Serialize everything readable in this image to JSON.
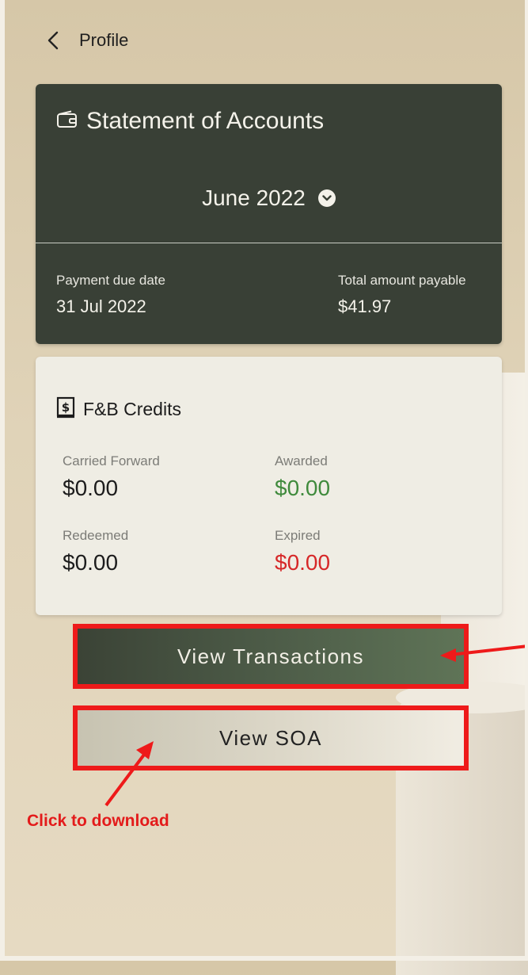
{
  "header": {
    "back_icon": "chevron-left-icon",
    "title": "Profile"
  },
  "statement": {
    "title": "Statement of Accounts",
    "icon": "wallet-icon",
    "selected_month": "June 2022",
    "payment_due_label": "Payment due date",
    "payment_due_value": "31 Jul 2022",
    "total_label": "Total amount payable",
    "total_value": "$41.97"
  },
  "credits": {
    "title": "F&B Credits",
    "icon": "dollar-receipt-icon",
    "items": [
      {
        "label": "Carried Forward",
        "value": "$0.00",
        "color": "#1c1c1c"
      },
      {
        "label": "Awarded",
        "value": "$0.00",
        "color": "#3f8a3c"
      },
      {
        "label": "Redeemed",
        "value": "$0.00",
        "color": "#1c1c1c"
      },
      {
        "label": "Expired",
        "value": "$0.00",
        "color": "#d62828"
      }
    ]
  },
  "buttons": {
    "transactions": "View Transactions",
    "soa": "View SOA"
  },
  "annotation": {
    "text": "Click to download",
    "color": "#e31b1b"
  }
}
